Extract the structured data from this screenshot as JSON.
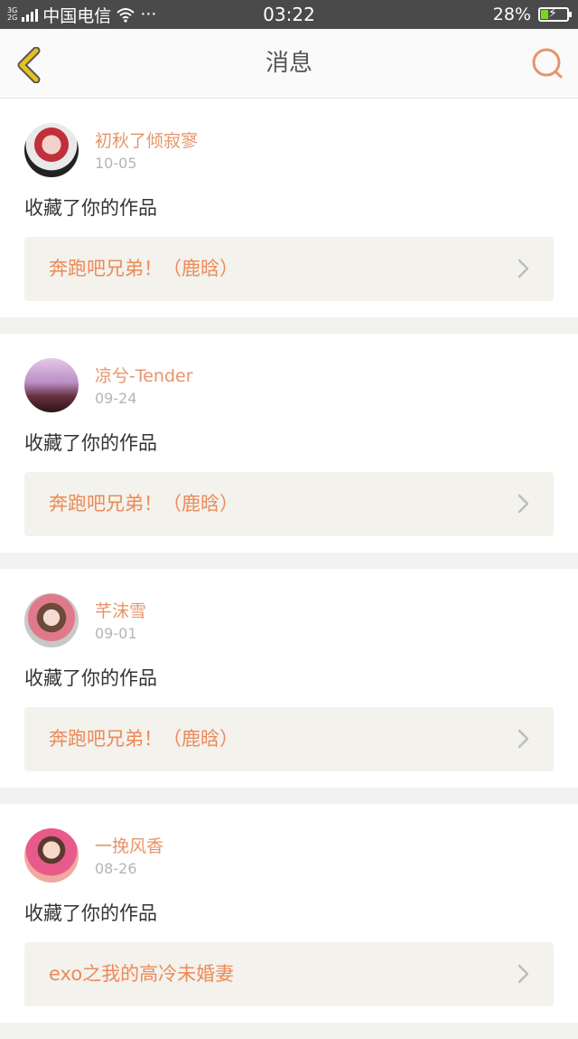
{
  "status_bar": {
    "net_top": "3G",
    "net_bottom": "2G",
    "carrier": "中国电信",
    "more": "···",
    "time": "03:22",
    "battery_text": "28%",
    "battery_level": 0.28
  },
  "header": {
    "title": "消息"
  },
  "messages": [
    {
      "user": "初秋了倾寂寥",
      "date": "10-05",
      "action": "收藏了你的作品",
      "work": "奔跑吧兄弟！（鹿晗）"
    },
    {
      "user": "凉兮-Tender",
      "date": "09-24",
      "action": "收藏了你的作品",
      "work": "奔跑吧兄弟！（鹿晗）"
    },
    {
      "user": "芊沫雪",
      "date": "09-01",
      "action": "收藏了你的作品",
      "work": "奔跑吧兄弟！（鹿晗）"
    },
    {
      "user": "一挽风香",
      "date": "08-26",
      "action": "收藏了你的作品",
      "work": "exo之我的高冷未婚妻"
    }
  ],
  "colors": {
    "accent": "#e8946a",
    "back_icon": "#e6c21e",
    "status_bar": "#4a4a4a"
  }
}
